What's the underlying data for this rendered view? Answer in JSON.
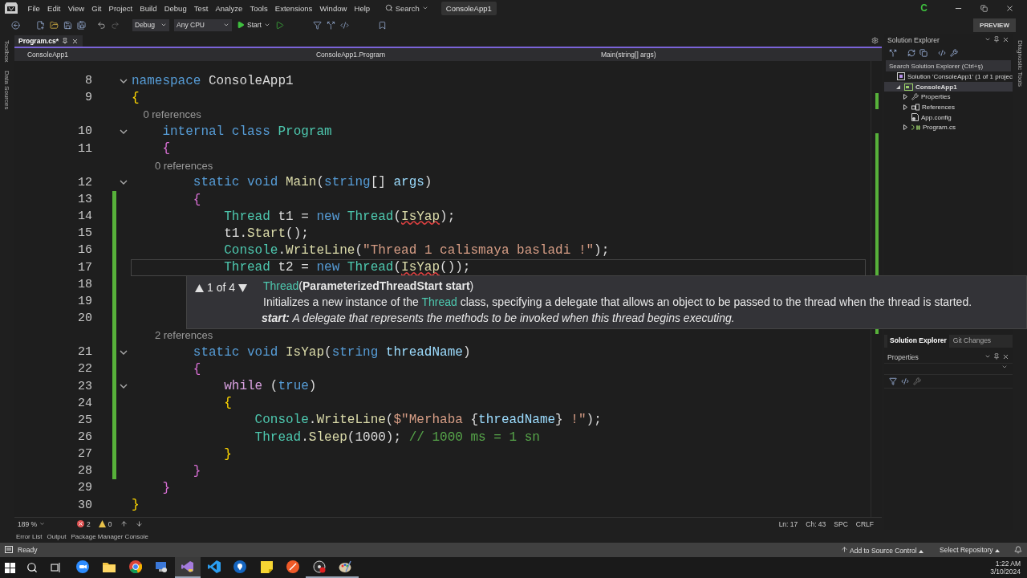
{
  "title_bar": {
    "menu": [
      "File",
      "Edit",
      "View",
      "Git",
      "Project",
      "Build",
      "Debug",
      "Test",
      "Analyze",
      "Tools",
      "Extensions",
      "Window",
      "Help"
    ],
    "search": "Search",
    "solution_name": "ConsoleApp1",
    "account_initial": "C"
  },
  "toolbar": {
    "configuration": "Debug",
    "platform": "Any CPU",
    "start": "Start",
    "preview": "PREVIEW"
  },
  "side_tabs_left": [
    "Toolbox",
    "Data Sources"
  ],
  "side_tabs_right": [
    "Diagnostic Tools"
  ],
  "editor": {
    "tabs": [
      {
        "label": "Program.cs*",
        "selected": true
      }
    ],
    "nav": [
      "ConsoleApp1",
      "ConsoleApp1.Program",
      "Main(string[] args)"
    ],
    "lines": [
      {
        "kind": "code",
        "number": "8",
        "fold": true,
        "changed": false,
        "current": false,
        "tokens": [
          {
            "kind": "keyword",
            "text": "namespace "
          },
          {
            "kind": "plain",
            "text": "ConsoleApp1"
          }
        ]
      },
      {
        "kind": "code",
        "number": "9",
        "fold": false,
        "changed": false,
        "current": false,
        "tokens": [
          {
            "kind": "brace1",
            "text": "{"
          }
        ]
      },
      {
        "kind": "lens",
        "text": "    0 references"
      },
      {
        "kind": "code",
        "number": "10",
        "fold": true,
        "changed": false,
        "current": false,
        "tokens": [
          {
            "kind": "keyword",
            "text": "    internal class "
          },
          {
            "kind": "type",
            "text": "Program"
          }
        ]
      },
      {
        "kind": "code",
        "number": "11",
        "fold": false,
        "changed": false,
        "current": false,
        "tokens": [
          {
            "kind": "brace2",
            "text": "    {"
          }
        ]
      },
      {
        "kind": "lens",
        "text": "        0 references"
      },
      {
        "kind": "code",
        "number": "12",
        "fold": true,
        "changed": false,
        "current": false,
        "tokens": [
          {
            "kind": "keyword",
            "text": "        static void "
          },
          {
            "kind": "method",
            "text": "Main"
          },
          {
            "kind": "plain",
            "text": "("
          },
          {
            "kind": "keyword",
            "text": "string"
          },
          {
            "kind": "plain",
            "text": "[] "
          },
          {
            "kind": "param",
            "text": "args"
          },
          {
            "kind": "plain",
            "text": ")"
          }
        ]
      },
      {
        "kind": "code",
        "number": "13",
        "fold": false,
        "changed": true,
        "current": false,
        "tokens": [
          {
            "kind": "brace2",
            "text": "        {"
          }
        ]
      },
      {
        "kind": "code",
        "number": "14",
        "fold": false,
        "changed": true,
        "current": false,
        "tokens": [
          {
            "kind": "type",
            "text": "            Thread"
          },
          {
            "kind": "plain",
            "text": " t1 = "
          },
          {
            "kind": "keyword",
            "text": "new "
          },
          {
            "kind": "type",
            "text": "Thread"
          },
          {
            "kind": "plain",
            "text": "("
          },
          {
            "kind": "method",
            "text": "IsYap",
            "error": true
          },
          {
            "kind": "plain",
            "text": ");"
          }
        ]
      },
      {
        "kind": "code",
        "number": "15",
        "fold": false,
        "changed": true,
        "current": false,
        "tokens": [
          {
            "kind": "plain",
            "text": "            t1."
          },
          {
            "kind": "method",
            "text": "Start"
          },
          {
            "kind": "plain",
            "text": "();"
          }
        ]
      },
      {
        "kind": "code",
        "number": "16",
        "fold": false,
        "changed": true,
        "current": false,
        "tokens": [
          {
            "kind": "type",
            "text": "            Console"
          },
          {
            "kind": "plain",
            "text": "."
          },
          {
            "kind": "method",
            "text": "WriteLine"
          },
          {
            "kind": "plain",
            "text": "("
          },
          {
            "kind": "string",
            "text": "\"Thread 1 calismaya basladi !\""
          },
          {
            "kind": "plain",
            "text": ");"
          }
        ]
      },
      {
        "kind": "code",
        "number": "17",
        "fold": false,
        "changed": true,
        "current": true,
        "tokens": [
          {
            "kind": "type",
            "text": "            Thread"
          },
          {
            "kind": "plain",
            "text": " t2 = "
          },
          {
            "kind": "keyword",
            "text": "new "
          },
          {
            "kind": "type",
            "text": "Thread"
          },
          {
            "kind": "plain",
            "text": "("
          },
          {
            "kind": "method",
            "text": "IsYap",
            "error": true
          },
          {
            "kind": "plain",
            "text": "());"
          }
        ]
      },
      {
        "kind": "code",
        "number": "18",
        "fold": false,
        "changed": true,
        "current": false
      },
      {
        "kind": "code",
        "number": "19",
        "fold": false,
        "changed": true,
        "current": false
      },
      {
        "kind": "code",
        "number": "20",
        "fold": false,
        "changed": true,
        "current": false
      },
      {
        "kind": "lens",
        "text": "        2 references"
      },
      {
        "kind": "code",
        "number": "21",
        "fold": true,
        "changed": true,
        "current": false,
        "tokens": [
          {
            "kind": "keyword",
            "text": "        static void "
          },
          {
            "kind": "method",
            "text": "IsYap"
          },
          {
            "kind": "plain",
            "text": "("
          },
          {
            "kind": "keyword",
            "text": "string "
          },
          {
            "kind": "param",
            "text": "threadName"
          },
          {
            "kind": "plain",
            "text": ")"
          }
        ]
      },
      {
        "kind": "code",
        "number": "22",
        "fold": false,
        "changed": true,
        "current": false,
        "tokens": [
          {
            "kind": "brace2",
            "text": "        {"
          }
        ]
      },
      {
        "kind": "code",
        "number": "23",
        "fold": true,
        "changed": true,
        "current": false,
        "tokens": [
          {
            "kind": "control",
            "text": "            while"
          },
          {
            "kind": "plain",
            "text": " ("
          },
          {
            "kind": "keyword",
            "text": "true"
          },
          {
            "kind": "plain",
            "text": ")"
          }
        ]
      },
      {
        "kind": "code",
        "number": "24",
        "fold": false,
        "changed": true,
        "current": false,
        "tokens": [
          {
            "kind": "brace1",
            "text": "            {"
          }
        ]
      },
      {
        "kind": "code",
        "number": "25",
        "fold": false,
        "changed": true,
        "current": false,
        "tokens": [
          {
            "kind": "type",
            "text": "                Console"
          },
          {
            "kind": "plain",
            "text": "."
          },
          {
            "kind": "method",
            "text": "WriteLine"
          },
          {
            "kind": "plain",
            "text": "("
          },
          {
            "kind": "string",
            "text": "$\"Merhaba "
          },
          {
            "kind": "plain",
            "text": "{"
          },
          {
            "kind": "param",
            "text": "threadName"
          },
          {
            "kind": "plain",
            "text": "}"
          },
          {
            "kind": "string",
            "text": " !\""
          },
          {
            "kind": "plain",
            "text": ");"
          }
        ]
      },
      {
        "kind": "code",
        "number": "26",
        "fold": false,
        "changed": true,
        "current": false,
        "tokens": [
          {
            "kind": "type",
            "text": "                Thread"
          },
          {
            "kind": "plain",
            "text": "."
          },
          {
            "kind": "method",
            "text": "Sleep"
          },
          {
            "kind": "plain",
            "text": "(1000); "
          },
          {
            "kind": "comment",
            "text": "// 1000 ms = 1 sn"
          }
        ]
      },
      {
        "kind": "code",
        "number": "27",
        "fold": false,
        "changed": true,
        "current": false,
        "tokens": [
          {
            "kind": "brace1",
            "text": "            }"
          }
        ]
      },
      {
        "kind": "code",
        "number": "28",
        "fold": false,
        "changed": true,
        "current": false,
        "tokens": [
          {
            "kind": "brace2",
            "text": "        }"
          }
        ]
      },
      {
        "kind": "code",
        "number": "29",
        "fold": false,
        "changed": false,
        "current": false,
        "tokens": [
          {
            "kind": "brace2",
            "text": "    }"
          }
        ]
      },
      {
        "kind": "code",
        "number": "30",
        "fold": false,
        "changed": false,
        "current": false,
        "tokens": [
          {
            "kind": "brace1",
            "text": "}"
          }
        ]
      }
    ],
    "tooltip": {
      "overload": "1 of 4",
      "name": "Thread",
      "parameters": "(**ParameterizedThreadStart start**)",
      "description_before": "Initializes a new instance of the ",
      "description_link": "Thread",
      "description_after": " class, specifying a delegate that allows an object to be passed to the thread when the thread is started.",
      "param_name": "start:",
      "param_text": "A delegate that represents the methods to be invoked when this thread begins executing."
    },
    "status": {
      "zoom": "189 %",
      "errors": "2",
      "warnings": "0",
      "line": "Ln: 17",
      "column": "Ch: 43",
      "indent": "SPC",
      "line_ending": "CRLF"
    }
  },
  "solution_explorer": {
    "title": "Solution Explorer",
    "search_placeholder": "Search Solution Explorer (Ctrl+ş)",
    "tree": [
      {
        "label": "Solution 'ConsoleApp1' (1 of 1 projec",
        "kind": "solution",
        "selected": false,
        "children": [
          {
            "label": "ConsoleApp1",
            "kind": "project",
            "expanded": true,
            "selected": true,
            "children": [
              {
                "label": "Properties",
                "kind": "properties",
                "expanded": false,
                "selected": false
              },
              {
                "label": "References",
                "kind": "references",
                "expanded": false,
                "selected": false
              },
              {
                "label": "App.config",
                "kind": "config",
                "selected": false
              },
              {
                "label": "Program.cs",
                "kind": "csharp",
                "expanded": false,
                "selected": false
              }
            ]
          }
        ]
      }
    ],
    "tabs": [
      {
        "label": "Solution Explorer",
        "selected": true
      },
      {
        "label": "Git Changes",
        "selected": false
      }
    ]
  },
  "properties": {
    "title": "Properties"
  },
  "tool_tabs": [
    "Error List",
    "Output",
    "Package Manager Console"
  ],
  "status_bar": {
    "text": "Ready",
    "source_control": "Add to Source Control",
    "repository": "Select Repository"
  },
  "taskbar": {
    "apps": [
      {
        "kind": "video",
        "selected": false,
        "running": false
      },
      {
        "kind": "folder",
        "selected": false,
        "running": false
      },
      {
        "kind": "browser",
        "selected": false,
        "running": false
      },
      {
        "kind": "remote",
        "selected": false,
        "running": false
      },
      {
        "kind": "ide",
        "selected": true,
        "running": true
      },
      {
        "kind": "editor",
        "selected": false,
        "running": false
      },
      {
        "kind": "maps",
        "selected": false,
        "running": false
      },
      {
        "kind": "notes",
        "selected": false,
        "running": false
      },
      {
        "kind": "compass",
        "selected": false,
        "running": false
      },
      {
        "kind": "recorder",
        "selected": false,
        "running": true
      },
      {
        "kind": "paint",
        "selected": false,
        "running": true
      }
    ],
    "time": "1:22 AM",
    "date": "3/10/2024"
  }
}
